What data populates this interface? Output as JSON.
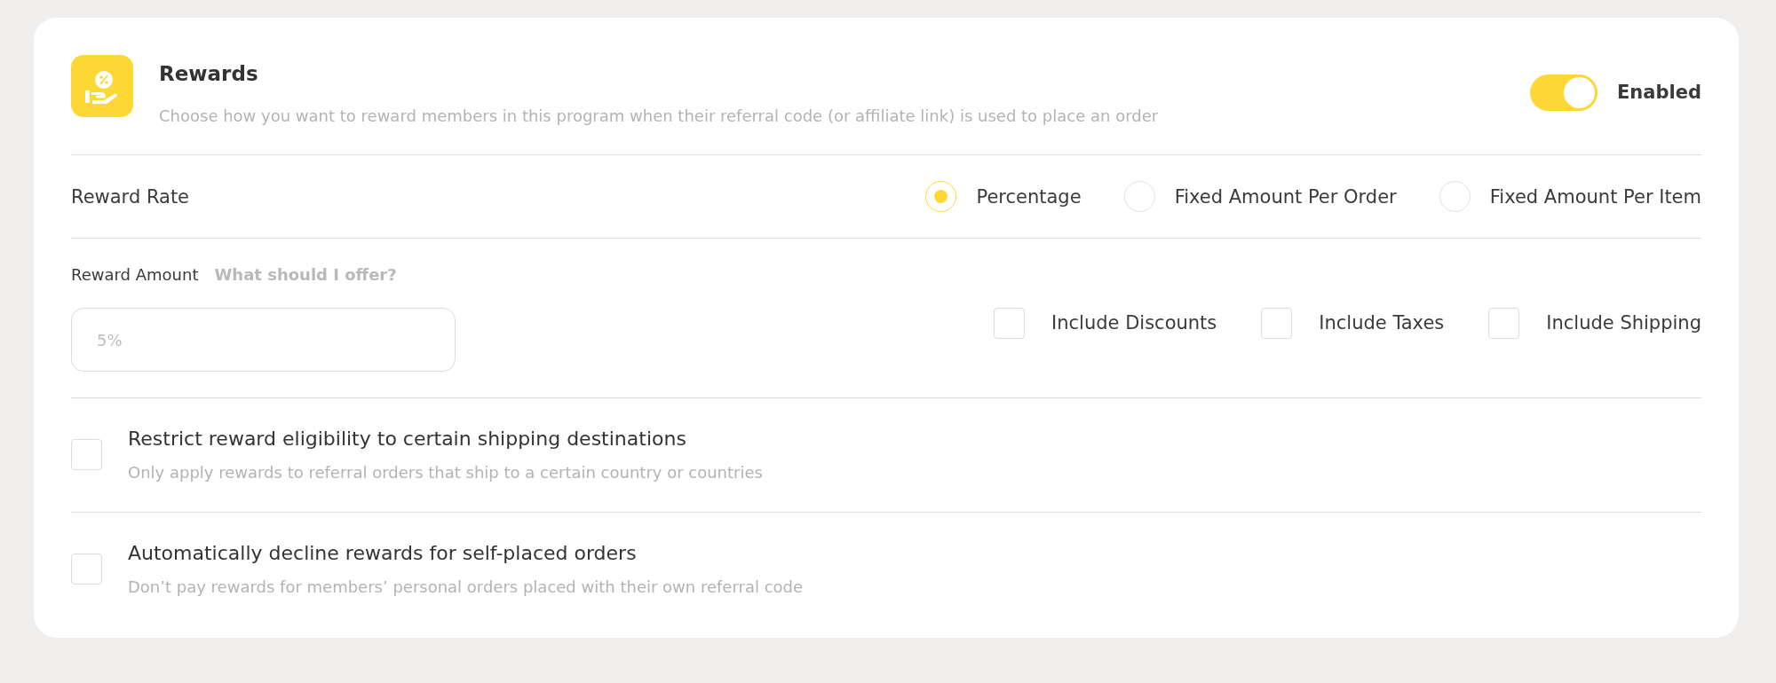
{
  "header": {
    "title": "Rewards",
    "description": "Choose how you want to reward members in this program when their referral code (or affiliate link) is used to place an order",
    "toggle": {
      "on": true,
      "label": "Enabled"
    }
  },
  "reward_rate": {
    "label": "Reward Rate",
    "options": [
      {
        "label": "Percentage",
        "selected": true
      },
      {
        "label": "Fixed Amount Per Order",
        "selected": false
      },
      {
        "label": "Fixed Amount Per Item",
        "selected": false
      }
    ]
  },
  "reward_amount": {
    "label": "Reward Amount",
    "help_link": "What should I offer?",
    "input": {
      "placeholder": "5%"
    },
    "includes": [
      {
        "label": "Include Discounts",
        "checked": false
      },
      {
        "label": "Include Taxes",
        "checked": false
      },
      {
        "label": "Include Shipping",
        "checked": false
      }
    ]
  },
  "options": [
    {
      "title": "Restrict reward eligibility to certain shipping destinations",
      "description": "Only apply rewards to referral orders that ship to a certain country or countries",
      "checked": false
    },
    {
      "title": "Automatically decline rewards for self-placed orders",
      "description": "Don’t pay rewards for members’ personal orders placed with their own referral code",
      "checked": false
    }
  ]
}
